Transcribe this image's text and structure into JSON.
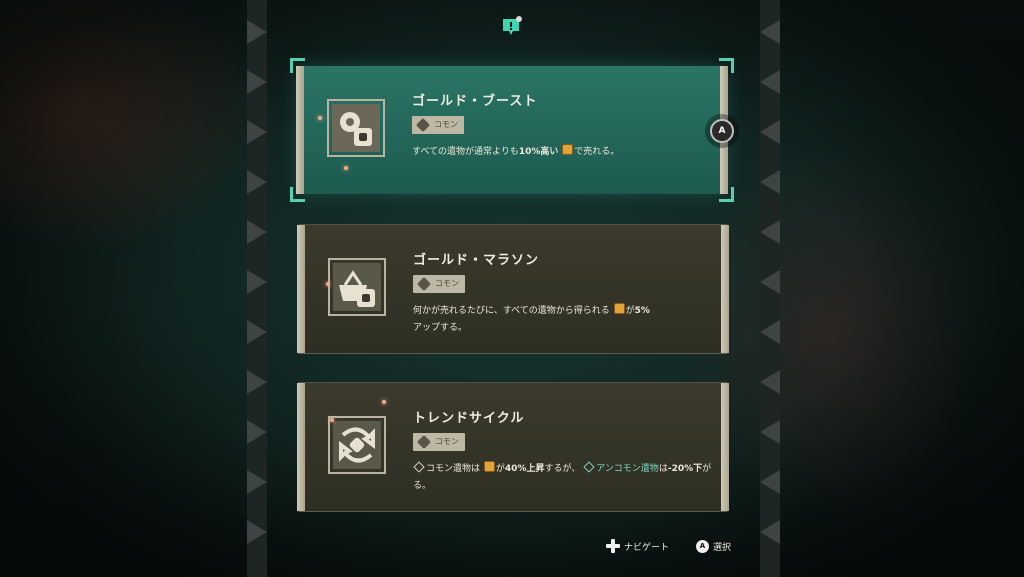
{
  "top_icon": "quest-marker-icon",
  "cards": [
    {
      "title": "ゴールド・ブースト",
      "rarity": "コモン",
      "emblem_icon": "gold-pouch-boost-icon",
      "desc_parts": [
        "すべての遺物が通常よりも",
        "10%高い",
        "で売れる。"
      ],
      "selected": true
    },
    {
      "title": "ゴールド・マラソン",
      "rarity": "コモン",
      "emblem_icon": "basket-boost-icon",
      "desc_parts": [
        "何かが売れるたびに、すべての遺物から得られる",
        "が",
        "5%",
        "アップする。"
      ],
      "selected": false
    },
    {
      "title": "トレンドサイクル",
      "rarity": "コモン",
      "emblem_icon": "cycle-arrows-icon",
      "desc_parts": [
        "コモン遺物",
        "は",
        "が",
        "40%上昇",
        "するが、",
        "アンコモン遺物",
        "は",
        "-20%下",
        "がる。"
      ],
      "selected": false
    }
  ],
  "confirm_button": {
    "label": "A"
  },
  "footer": {
    "nav_label": "ナビゲート",
    "select_button": "A",
    "select_label": "選択"
  },
  "colors": {
    "selected_card": "#2b7566",
    "card": "#3b3a2c",
    "accent": "#58d0b0",
    "coin": "#e0a53a"
  }
}
